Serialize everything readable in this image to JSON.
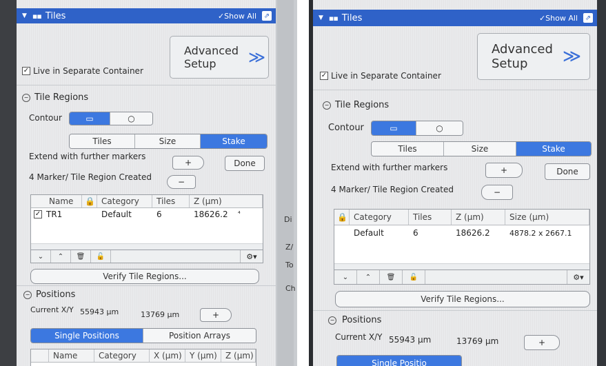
{
  "left": {
    "titlebar": {
      "dropdown_glyph": "▼",
      "grip_glyph": "▪▪",
      "title": "Tiles",
      "show_all": "✓Show All",
      "popout_glyph": "⇗"
    },
    "advanced_setup": {
      "line1": "Advanced",
      "line2": "Setup",
      "chevron": "≫"
    },
    "live_container": {
      "checked": true,
      "check_glyph": "✓",
      "label": "Live in Separate Container"
    },
    "tile_regions": {
      "collapse_glyph": "−",
      "heading": "Tile Regions"
    },
    "contour": {
      "label": "Contour",
      "rect_glyph": "▭",
      "ellipse_glyph": "○",
      "selected": "rectangle"
    },
    "mode_tabs": {
      "items": [
        "Tiles",
        "Size",
        "Stake"
      ],
      "selected": "Stake"
    },
    "extend": {
      "label": "Extend with further markers",
      "plus": "+",
      "done": "Done"
    },
    "marker_status": {
      "label": "4 Marker/ Tile Region Created",
      "minus": "−"
    },
    "region_table": {
      "headers": [
        "Name",
        "🔒",
        "Category",
        "Tiles",
        "Z (µm)"
      ],
      "rows": [
        {
          "checked": true,
          "check_glyph": "✓",
          "name": "TR1",
          "category": "Default",
          "tiles": "6",
          "z": "18626.2",
          "more": "⁴"
        }
      ]
    },
    "table_toolbar": {
      "down": "⌄",
      "up": "⌃",
      "trash": "🗑",
      "lock": "🔓",
      "gear": "⚙▾"
    },
    "verify": "Verify Tile Regions...",
    "positions": {
      "collapse_glyph": "−",
      "heading": "Positions"
    },
    "current_xy": {
      "label": "Current X/Y",
      "x": "55943 µm",
      "y": "13769 µm",
      "plus": "+"
    },
    "pos_tabs": {
      "items": [
        "Single Positions",
        "Position Arrays"
      ],
      "selected": "Single Positions"
    },
    "pos_table": {
      "headers": [
        "",
        "Name",
        "Category",
        "X (µm)",
        "Y (µm)",
        "Z (µm)"
      ]
    },
    "side_letters": [
      "Di",
      "Z/",
      "To",
      "Ch"
    ]
  },
  "right": {
    "titlebar": {
      "dropdown_glyph": "▼",
      "grip_glyph": "▪▪",
      "title": "Tiles",
      "show_all": "✓Show All",
      "popout_glyph": "⇗"
    },
    "advanced_setup": {
      "line1": "Advanced",
      "line2": "Setup",
      "chevron": "≫"
    },
    "live_container": {
      "checked": true,
      "check_glyph": "✓",
      "label": "Live in Separate Container"
    },
    "tile_regions": {
      "collapse_glyph": "−",
      "heading": "Tile Regions"
    },
    "contour": {
      "label": "Contour",
      "rect_glyph": "▭",
      "ellipse_glyph": "○",
      "selected": "rectangle"
    },
    "mode_tabs": {
      "items": [
        "Tiles",
        "Size",
        "Stake"
      ],
      "selected": "Stake"
    },
    "extend": {
      "label": "Extend with further markers",
      "plus": "+",
      "done": "Done"
    },
    "marker_status": {
      "label": "4 Marker/ Tile Region Created",
      "minus": "−"
    },
    "region_table": {
      "headers": [
        "🔒",
        "Category",
        "Tiles",
        "Z (µm)",
        "Size (µm)"
      ],
      "rows": [
        {
          "category": "Default",
          "tiles": "6",
          "z": "18626.2",
          "size": "4878.2 x 2667.1"
        }
      ]
    },
    "table_toolbar": {
      "down": "⌄",
      "up": "⌃",
      "trash": "🗑",
      "lock": "🔓",
      "gear": "⚙▾"
    },
    "verify": "Verify Tile Regions...",
    "positions": {
      "collapse_glyph": "−",
      "heading": "Positions"
    },
    "current_xy": {
      "label": "Current X/Y",
      "x": "55943 µm",
      "y": "13769 µm",
      "plus": "+"
    },
    "pos_tabs": {
      "items": [
        "Single Positio"
      ],
      "selected": "Single Positio"
    }
  }
}
